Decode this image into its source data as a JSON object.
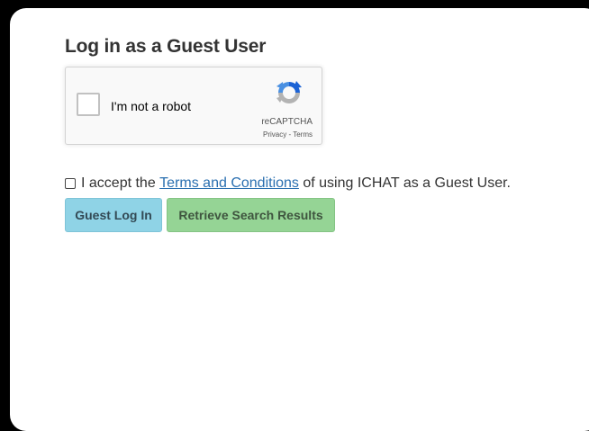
{
  "login": {
    "title": "Log in as a Guest User"
  },
  "recaptcha": {
    "label": "I'm not a robot",
    "brand": "reCAPTCHA",
    "privacy": "Privacy",
    "separator": " - ",
    "terms": "Terms",
    "logo_icon": "recaptcha-logo-icon"
  },
  "terms": {
    "prefix": "I accept the ",
    "link": "Terms and Conditions",
    "suffix": " of using ICHAT as a Guest User.",
    "checked": false
  },
  "buttons": {
    "guest_login": "Guest Log In",
    "retrieve": "Retrieve Search Results"
  },
  "colors": {
    "guest_button": "#8fd3e6",
    "retrieve_button": "#95d495",
    "link": "#2a6fb0"
  }
}
